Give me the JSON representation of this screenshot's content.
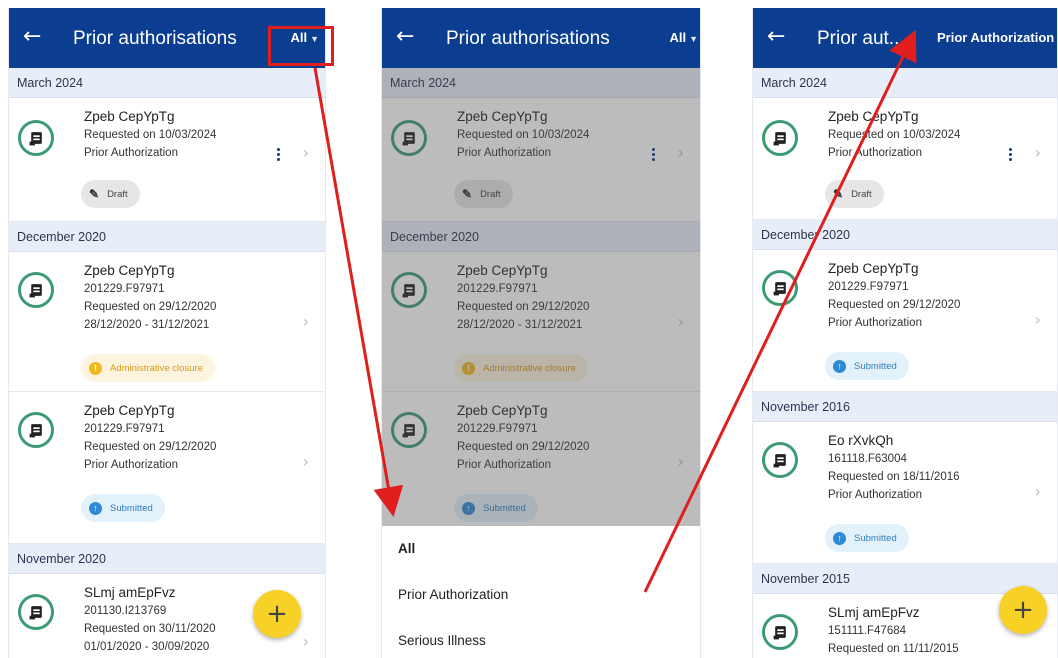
{
  "title": "Prior authorisations",
  "title_truncated": "Prior aut...",
  "filter_all": "All",
  "filter_prior": "Prior Authorization",
  "months": {
    "march_2024": "March 2024",
    "december_2020": "December 2020",
    "november_2020": "November 2020",
    "november_2016": "November 2016",
    "november_2015": "November 2015"
  },
  "items": {
    "a": {
      "name": "Zpeb CepYpTg",
      "l1": "Requested on 10/03/2024",
      "l2": "Prior Authorization",
      "status": "Draft"
    },
    "b": {
      "name": "Zpeb CepYpTg",
      "l1": "201229.F97971",
      "l2": "Requested on 29/12/2020",
      "l3": "28/12/2020 - 31/12/2021",
      "status": "Administrative closure"
    },
    "c": {
      "name": "Zpeb CepYpTg",
      "l1": "201229.F97971",
      "l2": "Requested on 29/12/2020",
      "l3": "Prior Authorization",
      "status": "Submitted"
    },
    "d": {
      "name": "SLmj amEpFvz",
      "l1": "201130.I213769",
      "l2": "Requested on 30/11/2020",
      "l3": "01/01/2020 - 30/09/2020"
    },
    "e": {
      "name": "Eo rXvkQh",
      "l1": "161118.F63004",
      "l2": "Requested on 18/11/2016",
      "l3": "Prior Authorization",
      "status": "Submitted"
    },
    "f": {
      "name": "SLmj amEpFvz",
      "l1": "151111.F47684",
      "l2": "Requested on 11/11/2015"
    }
  },
  "sheet": [
    "All",
    "Prior Authorization",
    "Serious Illness"
  ],
  "fab_label": "+",
  "icons": {
    "back": "back-arrow-icon",
    "doc": "document-icon",
    "chevron": "chevron-right-icon",
    "more": "more-vertical-icon",
    "draft": "edit-icon",
    "admin": "alert-icon",
    "submitted": "arrow-up-icon"
  },
  "colors": {
    "appbar": "#0b3d91",
    "month_bg": "#e8eef9",
    "icon_ring": "#3d9b74",
    "fab": "#f7d126",
    "annotation": "#e01e1e"
  }
}
